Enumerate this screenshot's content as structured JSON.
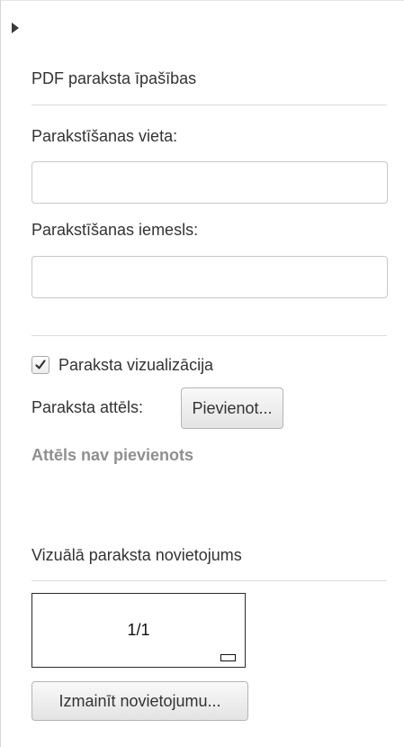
{
  "pdf_properties": {
    "title": "PDF paraksta īpašības",
    "location_label": "Parakstīšanas vieta:",
    "location_value": "",
    "reason_label": "Parakstīšanas iemesls:",
    "reason_value": ""
  },
  "visualization": {
    "checkbox_label": "Paraksta vizualizācija",
    "checkbox_checked": true,
    "image_label": "Paraksta attēls:",
    "add_button_label": "Pievienot...",
    "image_status": "Attēls nav pievienots"
  },
  "positioning": {
    "title": "Vizuālā paraksta novietojums",
    "page_indicator": "1/1",
    "change_button_label": "Izmainīt novietojumu..."
  },
  "colors": {
    "status_text": "#8f8f8f",
    "divider": "#dcdcdc",
    "text": "#333333"
  },
  "icons": {
    "toggle": "triangle-right-icon",
    "checkmark": "checkmark-icon"
  }
}
